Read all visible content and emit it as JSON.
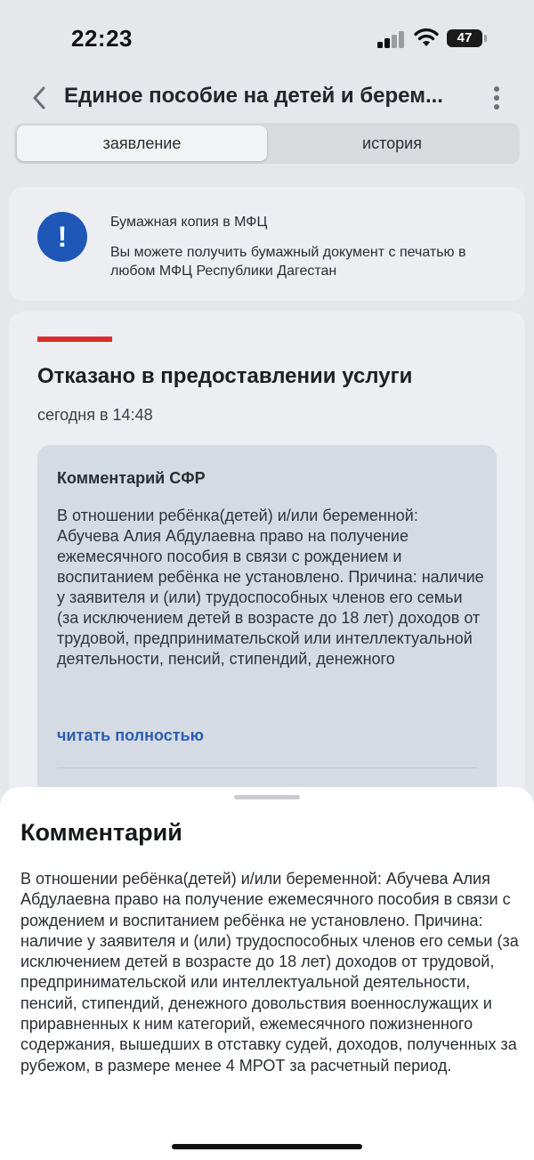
{
  "status_bar": {
    "time": "22:23",
    "battery": "47"
  },
  "header": {
    "title": "Единое пособие на детей и берем..."
  },
  "tabs": [
    {
      "label": "заявление",
      "active": true
    },
    {
      "label": "история",
      "active": false
    }
  ],
  "info_card": {
    "icon": "!",
    "title": "Бумажная копия в МФЦ",
    "text": "Вы можете получить бумажный документ с печатью в любом МФЦ Республики Дагестан"
  },
  "status_card": {
    "title": "Отказано в предоставлении услуги",
    "date": "сегодня в 14:48",
    "comment_label": "Комментарий СФР",
    "comment_text": "В отношении ребёнка(детей) и/или беременной: Абучева Алия Абдулаевна право на получение ежемесячного пособия в связи с рождением и воспитанием ребёнка не установлено. Причина: наличие у заявителя и (или) трудоспособных членов его семьи (за исключением детей в возрасте до 18 лет) доходов от трудовой, предпринимательской или интеллектуальной деятельности, пенсий, стипендий, денежного довольствия военнослужащих и приравненных…",
    "read_more": "читать полностью"
  },
  "sheet": {
    "title": "Комментарий",
    "text": "В отношении ребёнка(детей) и/или беременной: Абучева Алия Абдулаевна право на получение ежемесячного пособия в связи с рождением и воспитанием ребёнка не установлено. Причина: наличие у заявителя и (или) трудоспособных членов его семьи (за исключением детей в возрасте до 18 лет) доходов от трудовой, предпринимательской или интеллектуальной деятельности, пенсий, стипендий, денежного довольствия военнослужащих и приравненных к ним категорий, ежемесячного пожизненного содержания, вышедших в отставку судей, доходов, полученных за рубежом, в размере менее 4 МРОТ за расчетный период."
  },
  "colors": {
    "accent": "#1f57b8",
    "link": "#2c5db0",
    "error": "#d72f2f"
  },
  "icons": [
    "cellular-signal-icon",
    "wifi-icon",
    "battery-icon",
    "chevron-left-icon",
    "more-vertical-icon",
    "exclamation-icon"
  ]
}
